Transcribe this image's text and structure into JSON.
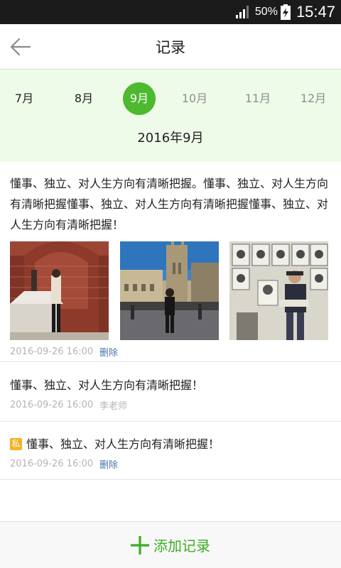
{
  "status_bar": {
    "battery": "50%",
    "time": "15:47"
  },
  "header": {
    "title": "记录"
  },
  "months": [
    {
      "label": "7月",
      "state": "normal"
    },
    {
      "label": "8月",
      "state": "normal"
    },
    {
      "label": "9月",
      "state": "selected"
    },
    {
      "label": "10月",
      "state": "future"
    },
    {
      "label": "11月",
      "state": "future"
    },
    {
      "label": "12月",
      "state": "future"
    }
  ],
  "current_date": "2016年9月",
  "records": [
    {
      "text": "懂事、独立、对人生方向有清晰把握。懂事、独立、对人生方向有清晰把握懂事、独立、对人生方向有清晰把握懂事、独立、对人生方向有清晰把握！",
      "photos": [
        "brick-wall-photo",
        "street-building-photo",
        "portrait-artist-photo"
      ],
      "date": "2016-09-26  16:00",
      "action": "删除"
    },
    {
      "text": "懂事、独立、对人生方向有清晰把握！",
      "date": "2016-09-26  16:00",
      "author": "李老师"
    },
    {
      "badge": "私",
      "text": "懂事、独立、对人生方向有清晰把握！",
      "date": "2016-09-26  16:00",
      "action": "删除"
    }
  ],
  "bottom": {
    "add_label": "添加记录"
  },
  "colors": {
    "accent": "#4cb92f",
    "band": "#effbe9",
    "link": "#4c73b2",
    "private": "#f4b223"
  }
}
